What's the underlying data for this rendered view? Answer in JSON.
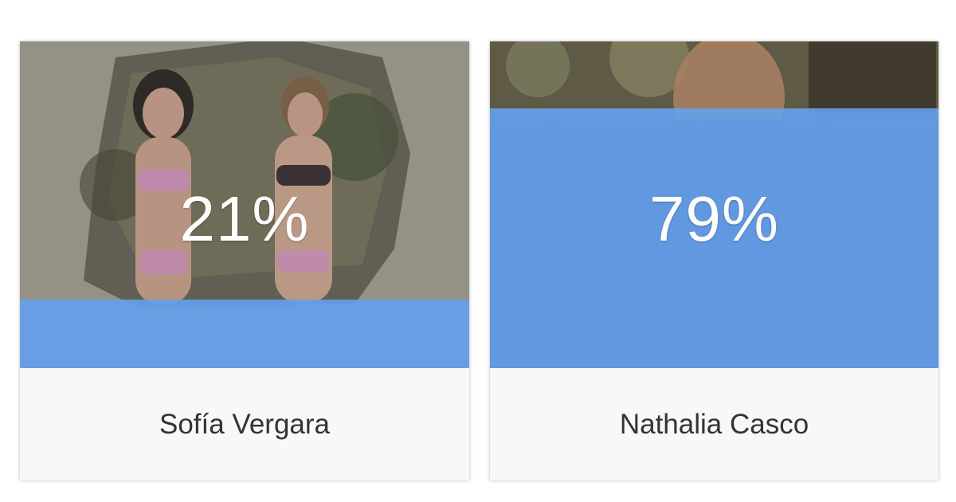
{
  "colors": {
    "bar_blue": "#66a0ec",
    "card_bg": "#f8f8f8",
    "name_text": "#333333",
    "percent_text": "#ffffff"
  },
  "options": [
    {
      "name": "Sofía Vergara",
      "percent_label": "21%",
      "vote_share": 0.21
    },
    {
      "name": "Nathalia Casco",
      "percent_label": "79%",
      "vote_share": 0.79
    }
  ]
}
